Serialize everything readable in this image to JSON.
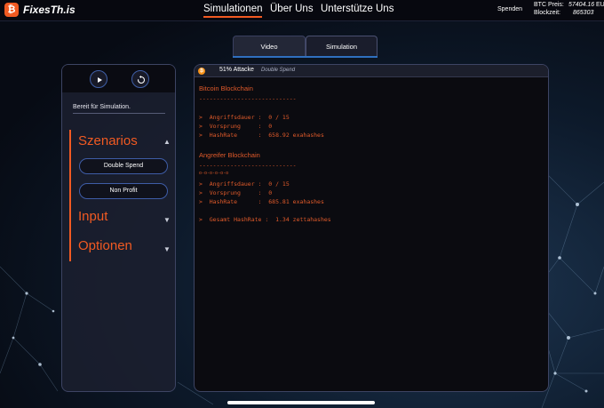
{
  "header": {
    "logo_glyph": "₿",
    "brand": "FixesTh.is",
    "nav": [
      "Simulationen",
      "Über Uns",
      "Unterstütze Uns"
    ],
    "donate": "Spenden",
    "btc_price_label": "BTC Preis:",
    "btc_price_value": "57404.16",
    "btc_currency": "EU",
    "block_time_label": "Blockzeit:",
    "block_time_value": "865303"
  },
  "tabs": [
    "Video",
    "Simulation"
  ],
  "sidebar": {
    "status": "Bereit für Simulation.",
    "sections": {
      "scenarios": "Szenarios",
      "input": "Input",
      "options": "Optionen"
    },
    "scenario_buttons": [
      "Double Spend",
      "Non Profit"
    ]
  },
  "console": {
    "title": "51% Attacke",
    "subtitle": "Double Spend",
    "bitcoin_title": "Bitcoin Blockchain",
    "bitcoin_separator": "----------------------------",
    "bitcoin_lines": [
      ">  Angriffsdauer :  0 / 15",
      ">  Vorsprung     :  0",
      ">  HashRate      :  658.92 exahashes"
    ],
    "attacker_title": "Angreifer Blockchain",
    "attacker_separator": "----------------------------",
    "attacker_chain": "o-o-o-o-o-o",
    "attacker_lines": [
      ">  Angriffsdauer :  0 / 15",
      ">  Vorsprung     :  0",
      ">  HashRate      :  685.81 exahashes"
    ],
    "total_hashrate": ">  Gesamt HashRate :  1.34 zettahashes"
  },
  "colors": {
    "accent": "#f15a22",
    "console_text": "#e05a2a",
    "button_border": "#3e5ca6",
    "tab_underline": "#2f6fbf"
  }
}
